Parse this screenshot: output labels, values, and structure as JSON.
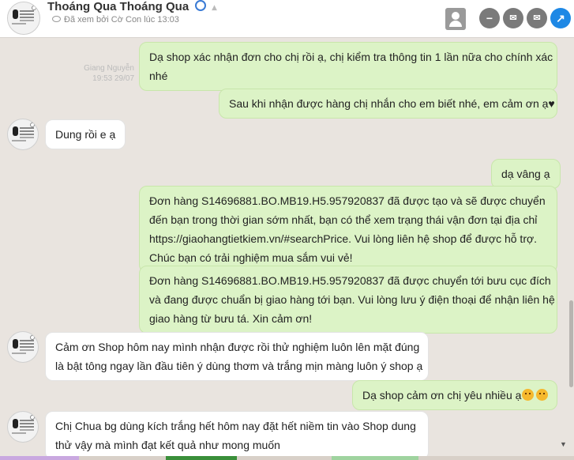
{
  "header": {
    "contact_name": "Thoáng Qua Thoáng Qua",
    "seen_status": "Đã xem bởi Cờ Con lúc 13:03",
    "icons": {
      "profile": "profile-icon",
      "minimize": "minimize-icon",
      "mail": "mail-icon",
      "inbox": "inbox-icon",
      "open": "open-external-icon"
    }
  },
  "sender_meta": {
    "name": "Giang Nguyễn",
    "time": "19:53 29/07"
  },
  "messages": [
    {
      "type": "sent",
      "lines": [
        "Dạ shop xác nhận đơn cho chị rồi ạ, chị kiểm tra thông tin 1 lần nữa cho chính xác",
        "nhé"
      ]
    },
    {
      "type": "sent",
      "lines": [
        "Sau khi nhận được hàng chị nhắn cho em biết nhé, em cảm ơn ạ♥"
      ]
    },
    {
      "type": "recv",
      "lines": [
        "Dung rồi e ạ"
      ]
    },
    {
      "type": "sent",
      "lines": [
        "dạ vâng ạ"
      ]
    },
    {
      "type": "sent",
      "lines": [
        "Đơn hàng S14696881.BO.MB19.H5.957920837 đã được tạo và sẽ được chuyển",
        "đến bạn trong thời gian sớm nhất, bạn có thể xem trạng thái vận đơn tại địa chỉ",
        "https://giaohangtietkiem.vn/#searchPrice. Vui lòng liên hệ shop để được hỗ trợ.",
        "Chúc bạn có trải nghiệm mua sắm vui vẻ!"
      ]
    },
    {
      "type": "sent",
      "lines": [
        "Đơn hàng S14696881.BO.MB19.H5.957920837 đã được chuyển tới bưu cục đích",
        "và đang được chuẩn bị giao hàng tới bạn. Vui lòng lưu ý điện thoại để nhận liên hệ",
        "giao hàng từ bưu tá. Xin cảm ơn!"
      ]
    },
    {
      "type": "recv",
      "lines": [
        "Cảm ơn Shop hôm nay mình nhận được rồi thử nghiệm luôn lên mặt đúng",
        "là bật tông ngay lần đầu tiên ý dùng thơm và trắng mịn màng luôn ý shop ạ"
      ]
    },
    {
      "type": "sent",
      "lines": [
        "Dạ shop cảm ơn chị yêu nhiều ạ"
      ]
    },
    {
      "type": "recv",
      "lines": [
        "Chị Chua bg dùng kích trắng hết hôm nay đặt hết niềm tin vào Shop dung",
        "thử vậy mà mình đạt kết quả như mong muốn"
      ]
    }
  ],
  "colors": {
    "sent_bubble": "#dcf3c6",
    "recv_bubble": "#ffffff",
    "chat_bg": "#e9e4df",
    "action_blue": "#1e88e5"
  }
}
